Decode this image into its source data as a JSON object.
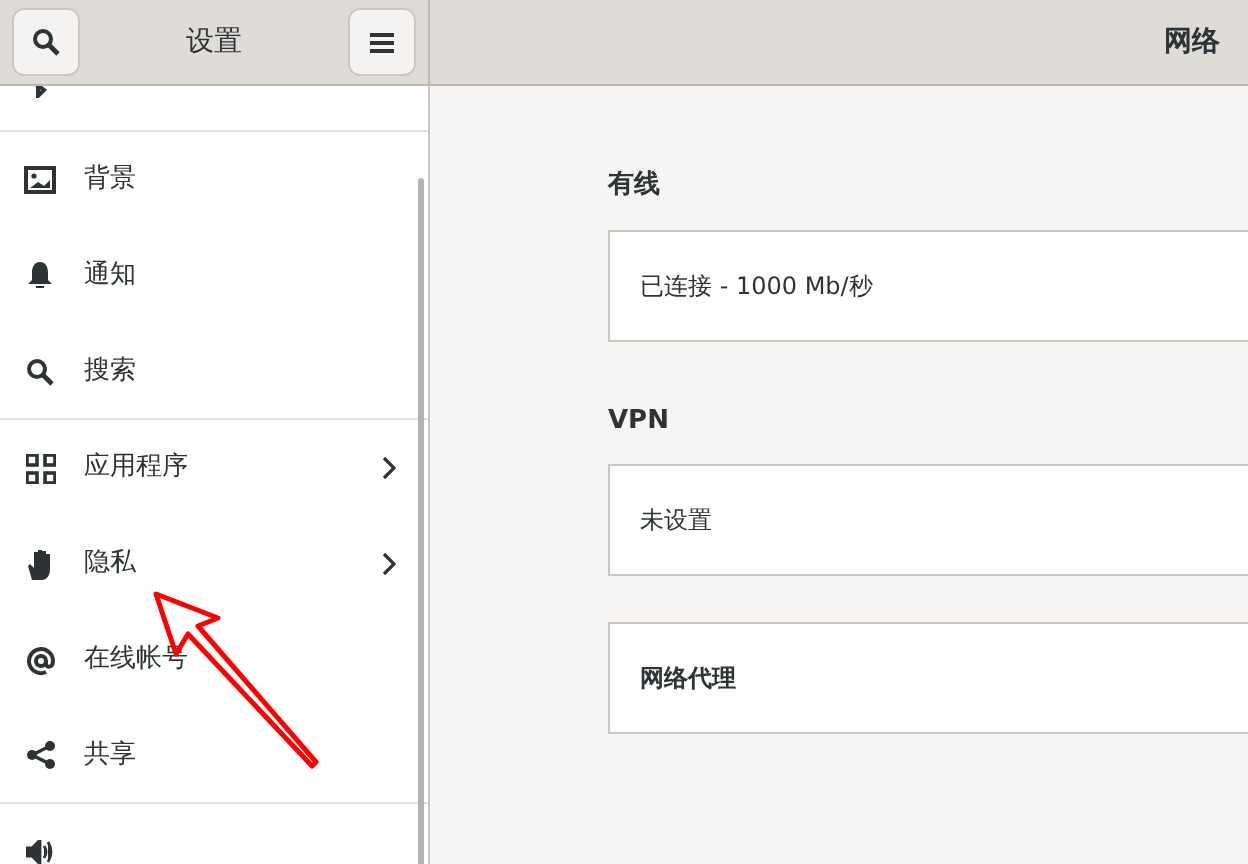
{
  "header": {
    "title": "设置",
    "panel_title": "网络"
  },
  "sidebar": {
    "items": [
      {
        "kind": "image",
        "label": "背景",
        "arrow": false
      },
      {
        "kind": "bell",
        "label": "通知",
        "arrow": false
      },
      {
        "kind": "search",
        "label": "搜索",
        "arrow": false
      },
      {
        "kind": "grid",
        "label": "应用程序",
        "arrow": true
      },
      {
        "kind": "hand",
        "label": "隐私",
        "arrow": true
      },
      {
        "kind": "at",
        "label": "在线帐号",
        "arrow": false
      },
      {
        "kind": "share",
        "label": "共享",
        "arrow": false
      }
    ]
  },
  "sections": [
    {
      "heading": "有线",
      "row": {
        "label": "已连接 - 1000 Mb/秒",
        "bold": false
      }
    },
    {
      "heading": "VPN",
      "row": {
        "label": "未设置",
        "bold": false
      }
    },
    {
      "row": {
        "label": "网络代理",
        "bold": true
      }
    }
  ]
}
